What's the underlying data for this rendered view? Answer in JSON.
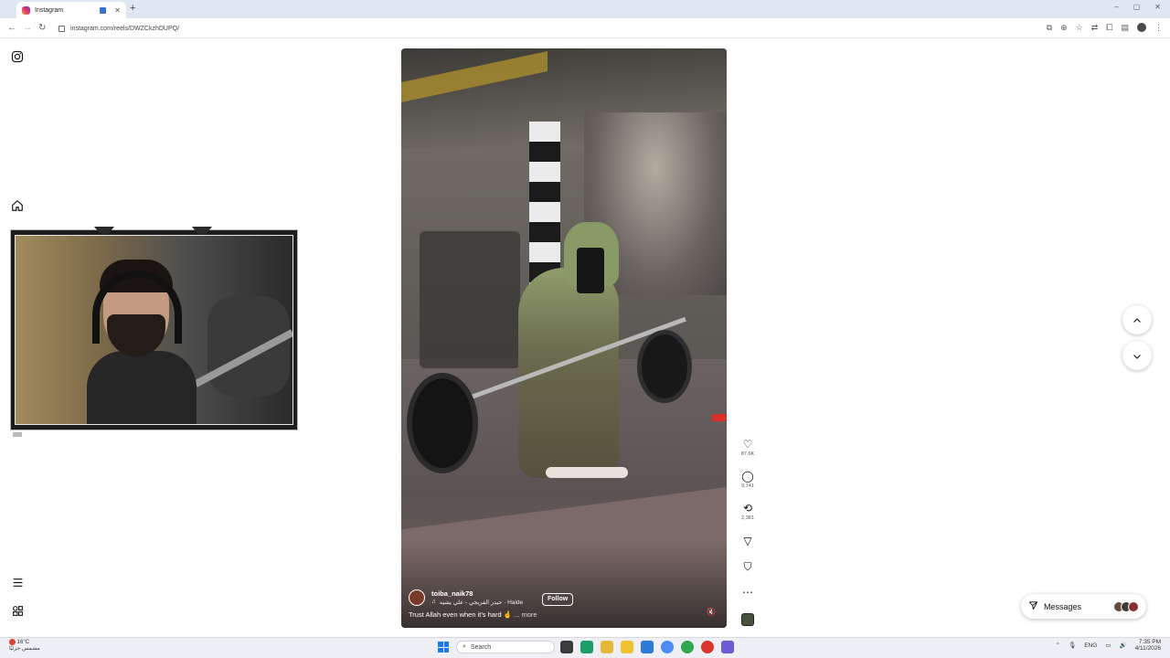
{
  "browser": {
    "tab_title": "Instagram",
    "tab_close": "✕",
    "new_tab": "+",
    "url": "instagram.com/reels/DWZCkzhDUPQ/",
    "back": "←",
    "forward": "→",
    "reload": "↻",
    "window_controls": [
      "–",
      "▢",
      "✕"
    ]
  },
  "sidebar": {
    "items": [
      {
        "name": "instagram-logo-icon"
      },
      {
        "name": "home-icon"
      },
      {
        "name": "menu-icon"
      },
      {
        "name": "meta-apps-icon"
      }
    ]
  },
  "reel": {
    "username": "toiba_naik78",
    "audio": "حيدر الفريجي - علي يشيه · Haide",
    "follow_label": "Follow",
    "caption": "Trust Allah even when it's hard 🤞",
    "more_label": "... more",
    "mute_icon": "speaker-muted-icon"
  },
  "actions": {
    "like_count": "87.6K",
    "comment_count": "9,741",
    "repost_count": "2,381"
  },
  "nav": {
    "up_icon": "⌃",
    "down_icon": "⌄"
  },
  "messages": {
    "label": "Messages"
  },
  "taskbar": {
    "weather_temp": "16°C",
    "weather_text": "مشمس جزئيًا",
    "search_placeholder": "Search",
    "language": "ENG",
    "time": "7:35 PM",
    "date": "4/11/2026"
  },
  "colors": {
    "accent": "#1b7be0",
    "instagram_gradient": [
      "#f9a13a",
      "#e1306c",
      "#833ab4"
    ]
  }
}
